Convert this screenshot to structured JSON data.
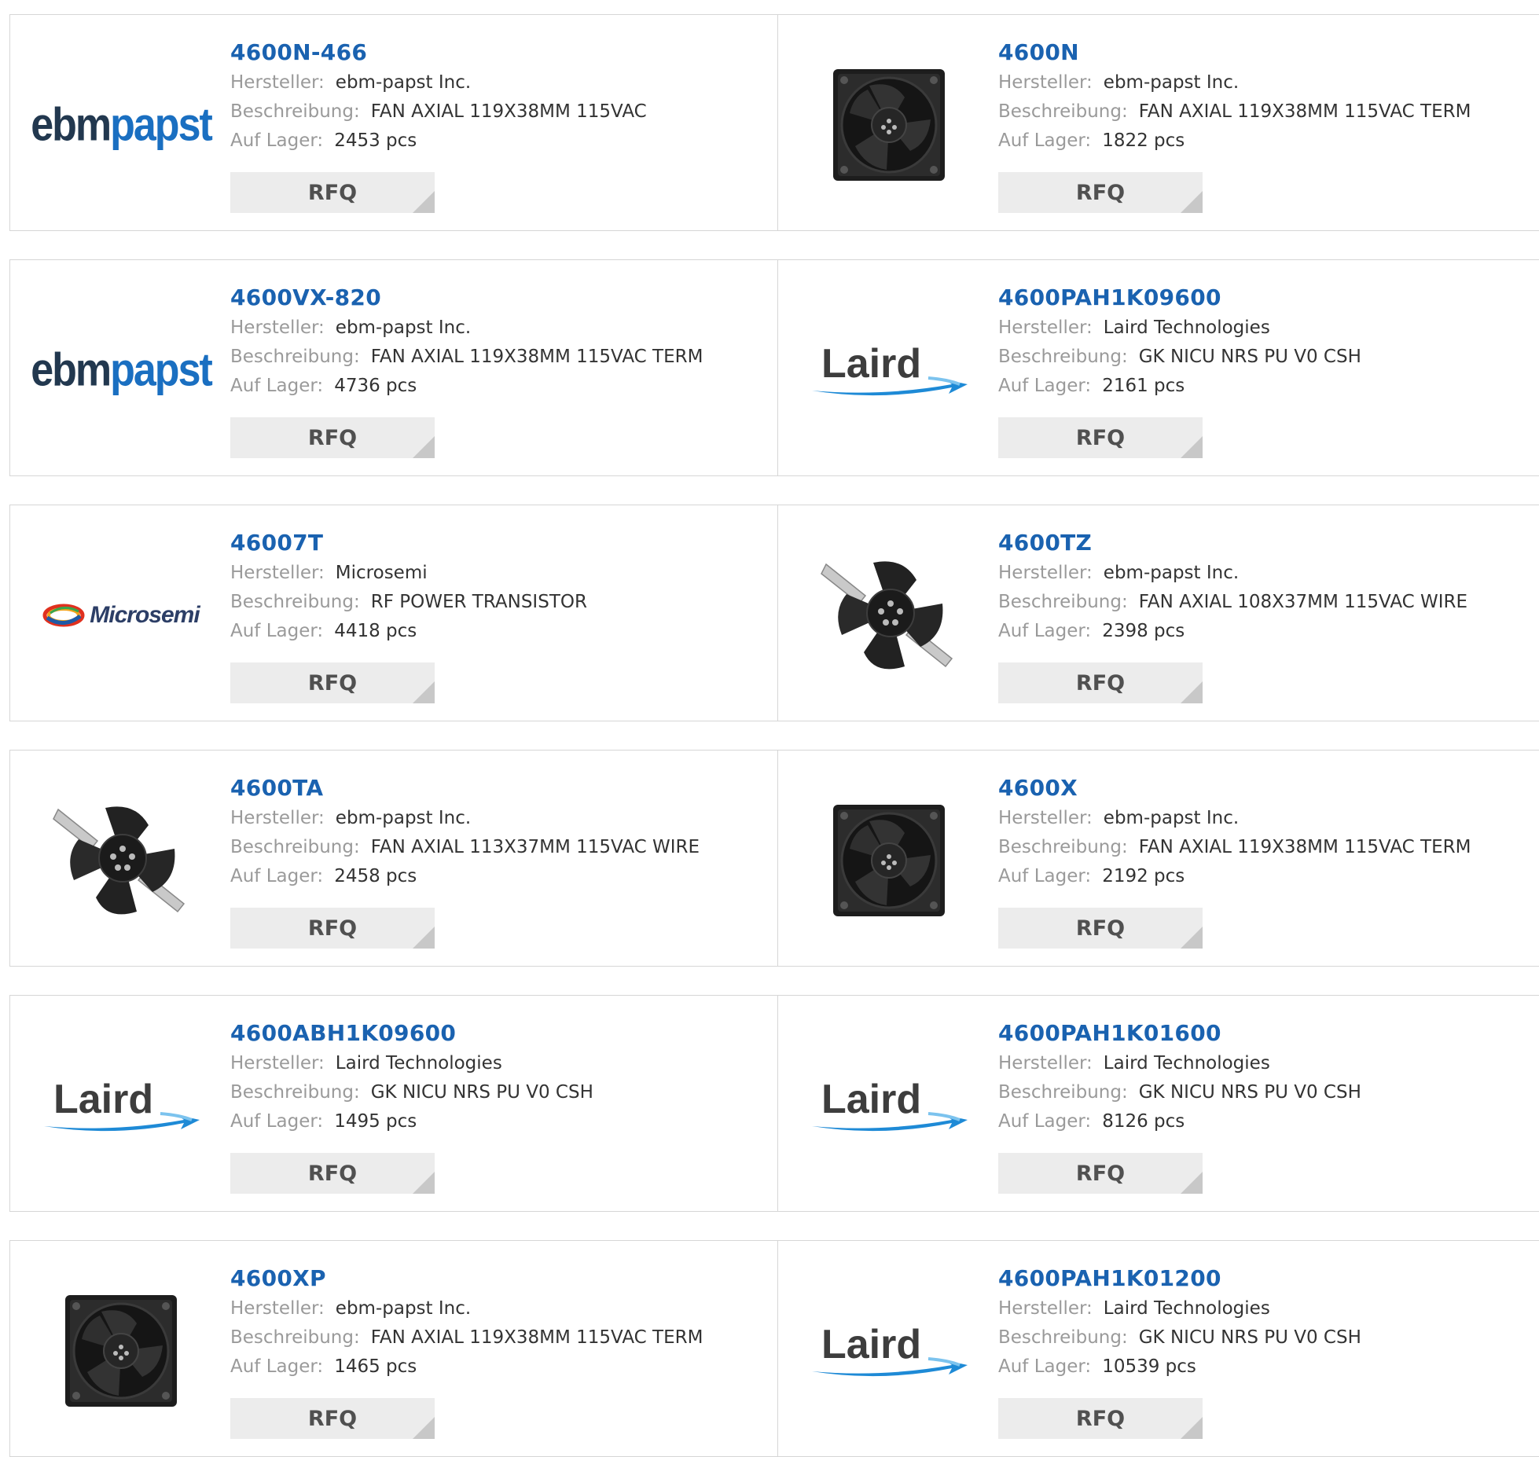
{
  "labels": {
    "manufacturer": "Hersteller:",
    "description": "Beschreibung:",
    "stock": "Auf Lager:",
    "rfq": "RFQ"
  },
  "products": [
    {
      "part": "4600N-466",
      "manufacturer": "ebm-papst Inc.",
      "description": "FAN AXIAL 119X38MM 115VAC",
      "stock": "2453 pcs",
      "logo": "ebmpapst-logo"
    },
    {
      "part": "4600N",
      "manufacturer": "ebm-papst Inc.",
      "description": "FAN AXIAL 119X38MM 115VAC TERM",
      "stock": "1822 pcs",
      "logo": "square-fan-icon"
    },
    {
      "part": "4600VX-820",
      "manufacturer": "ebm-papst Inc.",
      "description": "FAN AXIAL 119X38MM 115VAC TERM",
      "stock": "4736 pcs",
      "logo": "ebmpapst-logo"
    },
    {
      "part": "4600PAH1K09600",
      "manufacturer": "Laird Technologies",
      "description": "GK NICU NRS PU V0 CSH",
      "stock": "2161 pcs",
      "logo": "laird-logo"
    },
    {
      "part": "46007T",
      "manufacturer": "Microsemi",
      "description": "RF POWER TRANSISTOR",
      "stock": "4418 pcs",
      "logo": "microsemi-logo"
    },
    {
      "part": "4600TZ",
      "manufacturer": "ebm-papst Inc.",
      "description": "FAN AXIAL 108X37MM 115VAC WIRE",
      "stock": "2398 pcs",
      "logo": "open-fan-icon"
    },
    {
      "part": "4600TA",
      "manufacturer": "ebm-papst Inc.",
      "description": "FAN AXIAL 113X37MM 115VAC WIRE",
      "stock": "2458 pcs",
      "logo": "open-fan-icon"
    },
    {
      "part": "4600X",
      "manufacturer": "ebm-papst Inc.",
      "description": "FAN AXIAL 119X38MM 115VAC TERM",
      "stock": "2192 pcs",
      "logo": "square-fan-icon"
    },
    {
      "part": "4600ABH1K09600",
      "manufacturer": "Laird Technologies",
      "description": "GK NICU NRS PU V0 CSH",
      "stock": "1495 pcs",
      "logo": "laird-logo"
    },
    {
      "part": "4600PAH1K01600",
      "manufacturer": "Laird Technologies",
      "description": "GK NICU NRS PU V0 CSH",
      "stock": "8126 pcs",
      "logo": "laird-logo"
    },
    {
      "part": "4600XP",
      "manufacturer": "ebm-papst Inc.",
      "description": "FAN AXIAL 119X38MM 115VAC TERM",
      "stock": "1465 pcs",
      "logo": "square-fan-icon"
    },
    {
      "part": "4600PAH1K01200",
      "manufacturer": "Laird Technologies",
      "description": "GK NICU NRS PU V0 CSH",
      "stock": "10539 pcs",
      "logo": "laird-logo"
    }
  ],
  "brand_text": {
    "ebm_dark": "ebm",
    "ebm_blue": "papst",
    "laird": "Laird",
    "microsemi": "Microsemi"
  },
  "colors": {
    "part_link": "#1a62b0",
    "label": "#9a9a9a",
    "value": "#333333",
    "rfq_bg": "#ececec",
    "border": "#d6d6d6"
  }
}
